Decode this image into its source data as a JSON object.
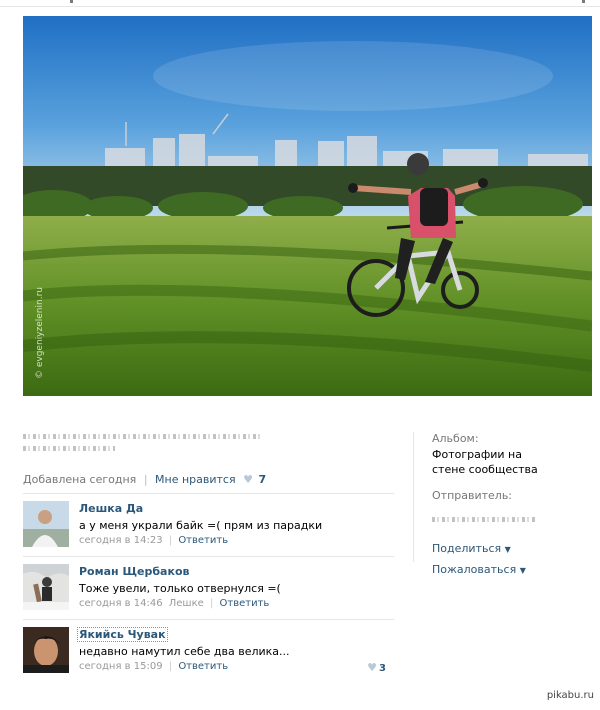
{
  "photo": {
    "watermark": "© evgeniyzelenin.ru"
  },
  "post": {
    "added": "Добавлена сегодня",
    "like_label": "Мне нравится",
    "like_count": "7"
  },
  "comments": [
    {
      "author": "Лешка Да",
      "text": "а у меня украли байк =( прям из парадки",
      "time": "сегодня в 14:23",
      "reply": "Ответить",
      "extra": ""
    },
    {
      "author": "Роман Щербаков",
      "text": "Тоже увели, только отвернулся =(",
      "time": "сегодня в 14:46",
      "reply": "Ответить",
      "extra": "Лешке"
    },
    {
      "author": "Якийсь Чувак",
      "text": "недавно намутил себе два велика...",
      "time": "сегодня в 15:09",
      "reply": "Ответить",
      "extra": "",
      "likes": "3"
    }
  ],
  "sidebar": {
    "album_label": "Альбом:",
    "album_value": "Фотографии на стене сообщества",
    "sender_label": "Отправитель:",
    "share": "Поделиться",
    "report": "Пожаловаться"
  },
  "footer": {
    "site": "pikabu.ru"
  }
}
